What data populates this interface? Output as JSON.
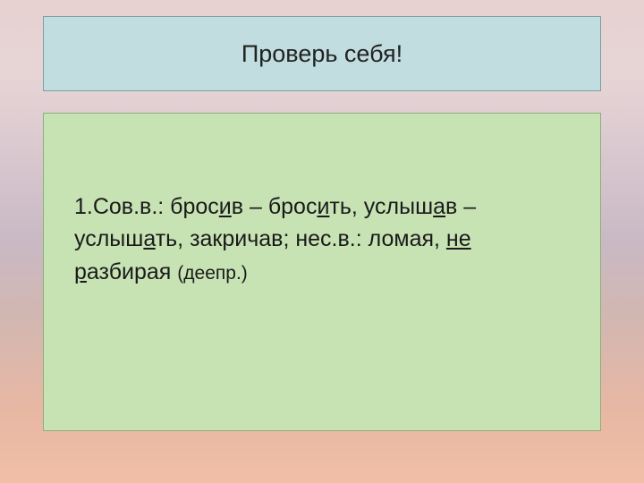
{
  "title": "Проверь себя!",
  "body": {
    "prefix": "1.Сов.в.: брос",
    "t1": "и",
    "t2": "в – брос",
    "t3": "и",
    "t4": "ть, услыш",
    "t5": "а",
    "t6": "в – услыш",
    "t7": "а",
    "t8": "ть, закричав; нес.в.:  ломая,  ",
    "t9": "не",
    "t10": " ",
    "t11": "р",
    "t12": "азбирая ",
    "note": "(деепр.)"
  }
}
